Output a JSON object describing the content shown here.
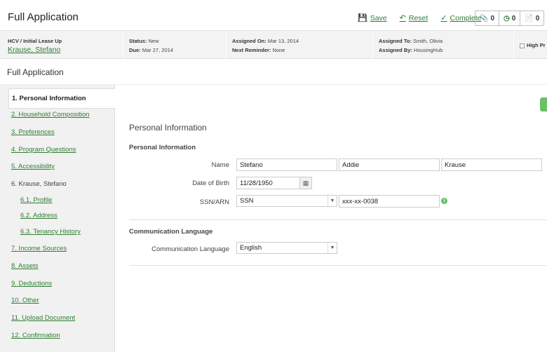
{
  "header": {
    "title": "Full Application",
    "actions": {
      "save": "Save",
      "reset": "Reset",
      "complete": "Complete"
    },
    "counters": [
      {
        "icon": "paperclip-icon",
        "value": "0"
      },
      {
        "icon": "clock-icon",
        "value": "0"
      },
      {
        "icon": "document-icon",
        "value": "0"
      }
    ]
  },
  "info": {
    "program": "HCV / Initial Lease Up",
    "name": "Krause, Stefano",
    "status_label": "Status:",
    "status": "New",
    "due_label": "Due:",
    "due": "Mar 27, 2014",
    "assigned_on_label": "Assigned On:",
    "assigned_on": "Mar 13, 2014",
    "next_reminder_label": "Next Reminder:",
    "next_reminder": "None",
    "assigned_to_label": "Assigned To:",
    "assigned_to": "Smith, Olivia",
    "assigned_by_label": "Assigned By:",
    "assigned_by": "HousingHub",
    "priority": "High Pr"
  },
  "subhead": {
    "title": "Full Application"
  },
  "sidebar": {
    "items": [
      {
        "label": "1. Personal Information"
      },
      {
        "label": "2. Household Composition"
      },
      {
        "label": "3. Preferences"
      },
      {
        "label": "4. Program Questions"
      },
      {
        "label": "5. Accessibility"
      },
      {
        "label": "6. Krause, Stefano"
      },
      {
        "label": "6.1. Profile"
      },
      {
        "label": "6.2. Address"
      },
      {
        "label": "6.3. Tenancy History"
      },
      {
        "label": "7. Income Sources"
      },
      {
        "label": "8. Assets"
      },
      {
        "label": "9. Deductions"
      },
      {
        "label": "10. Other"
      },
      {
        "label": "11. Upload Document"
      },
      {
        "label": "12. Confirmation"
      }
    ]
  },
  "main": {
    "section_title": "Personal Information",
    "personal": {
      "group_title": "Personal Information",
      "name_label": "Name",
      "first_name": "Stefano",
      "middle_name": "Addie",
      "last_name": "Krause",
      "dob_label": "Date of Birth",
      "dob": "11/28/1950",
      "ssn_label": "SSN/ARN",
      "ssn_type": "SSN",
      "ssn_value": "xxx-xx-0038"
    },
    "communication": {
      "group_title": "Communication Language",
      "label": "Communication Language",
      "value": "English"
    }
  }
}
